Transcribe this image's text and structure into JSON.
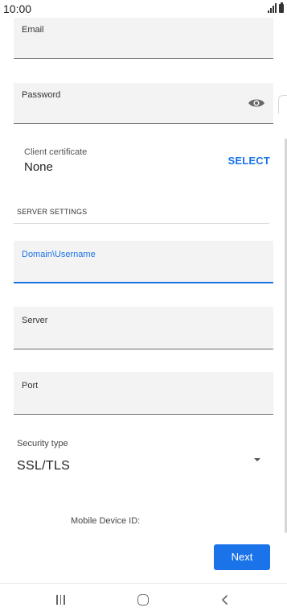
{
  "status_bar": {
    "time": "10:00",
    "icons": [
      "signal-icon",
      "battery-icon"
    ]
  },
  "form": {
    "email": {
      "label": "Email",
      "value": ""
    },
    "password": {
      "label": "Password",
      "value": "",
      "icon": "eye-icon"
    },
    "client_certificate": {
      "label": "Client certificate",
      "value": "None",
      "action": "SELECT"
    },
    "server_settings_header": "SERVER SETTINGS",
    "domain_username": {
      "label": "Domain\\Username",
      "value": "",
      "focused": true
    },
    "server": {
      "label": "Server",
      "value": ""
    },
    "port": {
      "label": "Port",
      "value": ""
    },
    "security_type": {
      "label": "Security type",
      "value": "SSL/TLS",
      "icon": "dropdown-arrow-icon"
    },
    "mobile_device_id": {
      "label": "Mobile Device ID:"
    }
  },
  "actions": {
    "next_label": "Next"
  },
  "colors": {
    "accent": "#1a73e8",
    "field_bg": "#f3f3f3",
    "field_underline": "#6f6f6f"
  },
  "nav_bar": {
    "icons": [
      "recent-apps-icon",
      "home-icon",
      "back-icon"
    ]
  }
}
